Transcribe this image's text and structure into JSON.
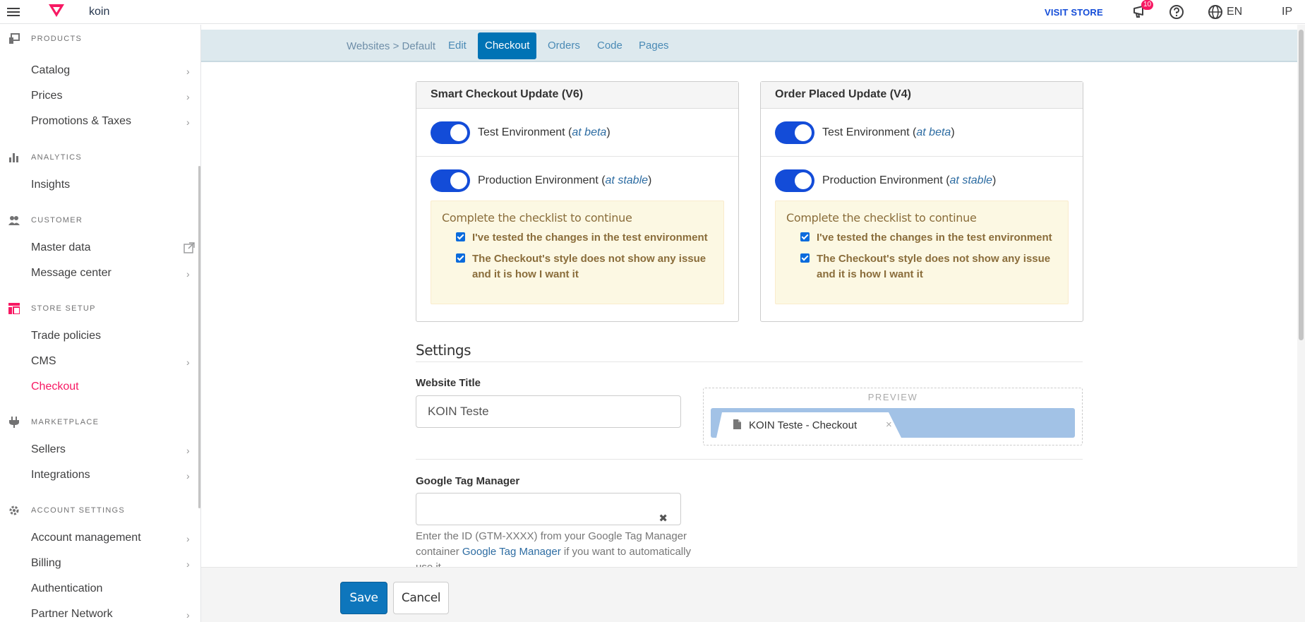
{
  "topbar": {
    "account_name": "koin",
    "visit_store": "VISIT STORE",
    "notifications_count": "10",
    "language": "EN",
    "user_initials": "IP",
    "brand_color": "#f71963"
  },
  "sidebar": {
    "sections": [
      {
        "title": "PRODUCTS",
        "icon": "products-icon",
        "items": [
          "Catalog",
          "Prices",
          "Promotions & Taxes"
        ]
      },
      {
        "title": "ANALYTICS",
        "icon": "analytics-icon",
        "items": [
          "Insights"
        ]
      },
      {
        "title": "CUSTOMER",
        "icon": "customer-icon",
        "items": [
          "Master data",
          "Message center"
        ]
      },
      {
        "title": "STORE SETUP",
        "icon": "store-setup-icon",
        "items": [
          "Trade policies",
          "CMS",
          "Checkout"
        ]
      },
      {
        "title": "MARKETPLACE",
        "icon": "marketplace-icon",
        "items": [
          "Sellers",
          "Integrations"
        ]
      },
      {
        "title": "ACCOUNT SETTINGS",
        "icon": "gear-icon",
        "items": [
          "Account management",
          "Billing",
          "Authentication",
          "Partner Network"
        ]
      }
    ],
    "active_item": "Checkout"
  },
  "tabs": {
    "breadcrumb": "Websites > Default",
    "items": [
      "Edit",
      "Checkout",
      "Orders",
      "Code",
      "Pages"
    ],
    "active": "Checkout"
  },
  "panels": [
    {
      "title": "Smart Checkout Update (V6)",
      "test_label": "Test Environment (",
      "test_tag": "at beta",
      "prod_label": "Production Environment (",
      "prod_tag": "at stable",
      "close_paren": ")",
      "checklist_title": "Complete the checklist to continue",
      "check1": "I've tested the changes in the test environment",
      "check2": "The Checkout's style does not show any issue and it is how I want it"
    },
    {
      "title": "Order Placed Update (V4)",
      "test_label": "Test Environment (",
      "test_tag": "at beta",
      "prod_label": "Production Environment (",
      "prod_tag": "at stable",
      "close_paren": ")",
      "checklist_title": "Complete the checklist to continue",
      "check1": "I've tested the changes in the test environment",
      "check2": "The Checkout's style does not show any issue and it is how I want it"
    }
  ],
  "settings": {
    "title": "Settings",
    "website_title_label": "Website Title",
    "website_title_value": "KOIN Teste",
    "preview_label": "PREVIEW",
    "preview_tab_title": "KOIN Teste - Checkout",
    "preview_close": "×",
    "gtm_label": "Google Tag Manager",
    "gtm_value": "",
    "gtm_clear": "✖",
    "help_prefix": "Enter the ID (GTM-XXXX) from your Google Tag Manager container ",
    "help_link": "Google Tag Manager",
    "help_suffix": " if you want to automatically use it."
  },
  "footer": {
    "save": "Save",
    "cancel": "Cancel"
  }
}
